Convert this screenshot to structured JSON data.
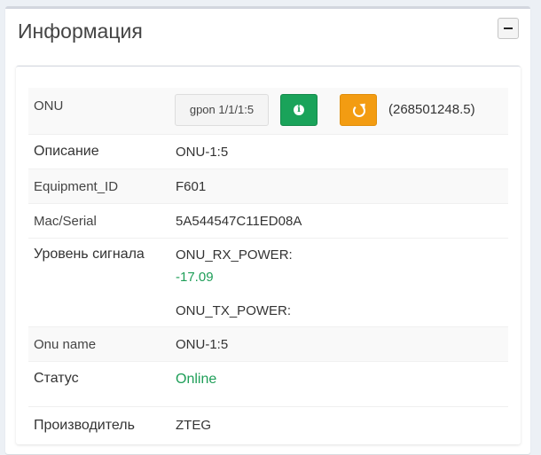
{
  "panel": {
    "title": "Информация",
    "collapse_icon": "minus-icon"
  },
  "onu": {
    "label": "ONU",
    "port_button": "gpon 1/1/1:5",
    "info_icon": "info-circle-icon",
    "refresh_icon": "refresh-icon",
    "info_color": "#1aa35a",
    "refresh_color": "#f39c12",
    "uptime": "(268501248.5)"
  },
  "rows": {
    "description": {
      "label": "Описание",
      "value": "ONU-1:5"
    },
    "equipment": {
      "label": "Equipment_ID",
      "value": "F601"
    },
    "mac": {
      "label": "Mac/Serial",
      "value": "5A544547C11ED08A"
    },
    "signal": {
      "label": "Уровень сигнала",
      "rx_label": "ONU_RX_POWER:",
      "rx_value": "-17.09",
      "tx_label": "ONU_TX_POWER:"
    },
    "onu_name": {
      "label": "Onu name",
      "value": "ONU-1:5"
    },
    "status": {
      "label": "Статус",
      "value": "Online",
      "color": "#1e9e58"
    },
    "vendor": {
      "label": "Производитель",
      "value": "ZTEG"
    }
  }
}
